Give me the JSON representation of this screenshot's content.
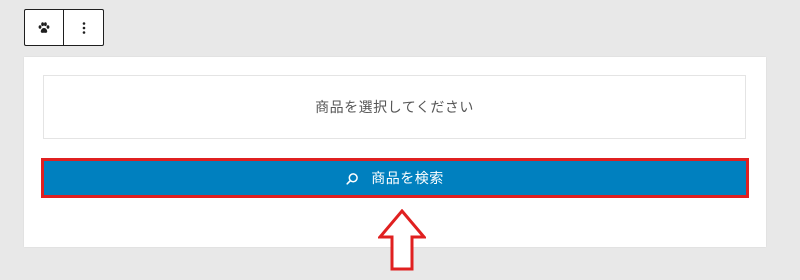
{
  "toolbar": {
    "icon_button_icon": "paw-icon",
    "more_button_icon": "more-vertical-icon"
  },
  "block": {
    "placeholder_text": "商品を選択してください",
    "search_button_label": "商品を検索",
    "search_button_icon": "search-icon"
  },
  "annotation": {
    "arrow_icon": "up-arrow-icon"
  },
  "colors": {
    "background": "#e8e8e8",
    "button_background": "#0080bf",
    "highlight_border": "#e02020",
    "toolbar_border": "#1e1e1e"
  }
}
